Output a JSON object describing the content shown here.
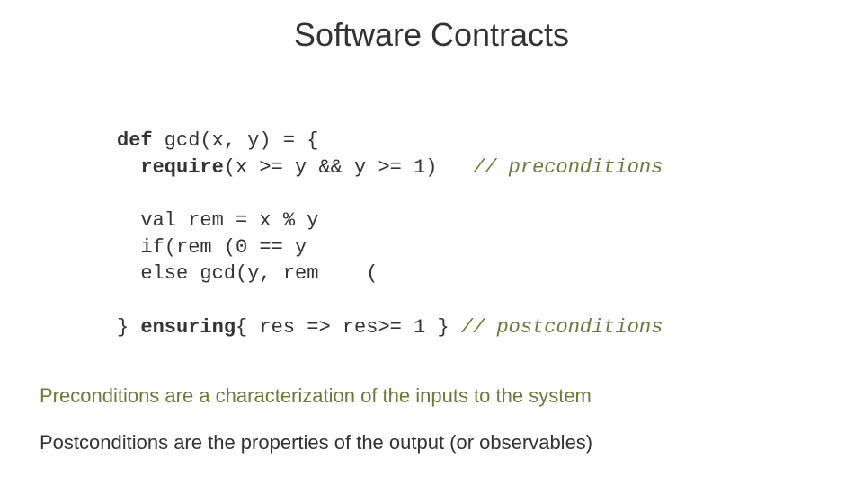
{
  "slide": {
    "title": "Software Contracts",
    "code": {
      "l1a": "def",
      "l1b": " gcd(x, y) = {",
      "l2a": "  require",
      "l2b": "(x >= y && y >= 1)   ",
      "l2c": "// preconditions",
      "l3": "",
      "l4": "  val rem = x % y",
      "l5": "  if(rem (0 == y",
      "l6": "  else gcd(y, rem    (",
      "l7": "",
      "l8a": "} ",
      "l8b": "ensuring",
      "l8c": "{ res => res>= 1 } ",
      "l8d": "// postconditions"
    },
    "body1": "Preconditions are a characterization  of the inputs to the system",
    "body2": "Postconditions are the properties of the output (or observables)"
  }
}
